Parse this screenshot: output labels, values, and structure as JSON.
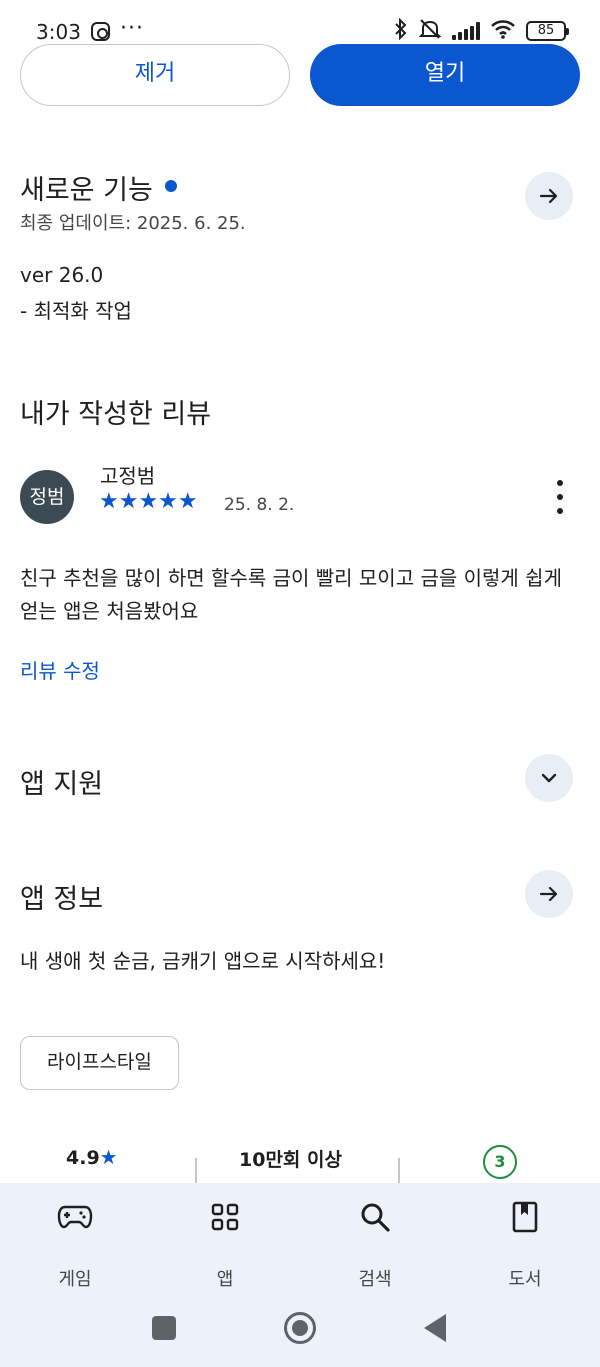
{
  "status_bar": {
    "time": "3:03",
    "more": "···",
    "battery": "85",
    "icons": [
      "instagram-icon",
      "bluetooth-icon",
      "mute-icon",
      "signal-icon",
      "wifi-icon",
      "battery-icon"
    ]
  },
  "actions": {
    "remove_label": "제거",
    "open_label": "열기"
  },
  "whats_new": {
    "title": "새로운 기능",
    "updated": "최종 업데이트: 2025. 6. 25.",
    "version": "ver 26.0",
    "note": "- 최적화 작업"
  },
  "my_review": {
    "title": "내가 작성한 리뷰",
    "avatar_text": "정범",
    "reviewer": "고정범",
    "stars": "★★★★★",
    "rating": 5,
    "date": "25. 8. 2.",
    "text": "친구 추천을 많이 하면 할수록 금이 빨리 모이고 금을 이렇게 쉽게 얻는 앱은 처음봤어요",
    "edit_label": "리뷰 수정"
  },
  "app_support": {
    "title": "앱 지원"
  },
  "app_info": {
    "title": "앱 정보",
    "description": "내 생애 첫 순금, 금캐기 앱으로 시작하세요!",
    "category": "라이프스타일"
  },
  "stats": {
    "rating": "4.9",
    "rating_star": "★",
    "downloads": "10만회 이상",
    "content_rating": "3"
  },
  "bottom_nav": {
    "items": [
      {
        "label": "게임",
        "icon": "gamepad-icon"
      },
      {
        "label": "앱",
        "icon": "apps-grid-icon"
      },
      {
        "label": "검색",
        "icon": "search-icon"
      },
      {
        "label": "도서",
        "icon": "book-icon"
      }
    ]
  },
  "colors": {
    "accent": "#0b57d0",
    "text": "#1f1f1f",
    "secondary_text": "#444746",
    "nav_background": "#edf2fa",
    "content_rating_green": "#1e8e3e"
  }
}
